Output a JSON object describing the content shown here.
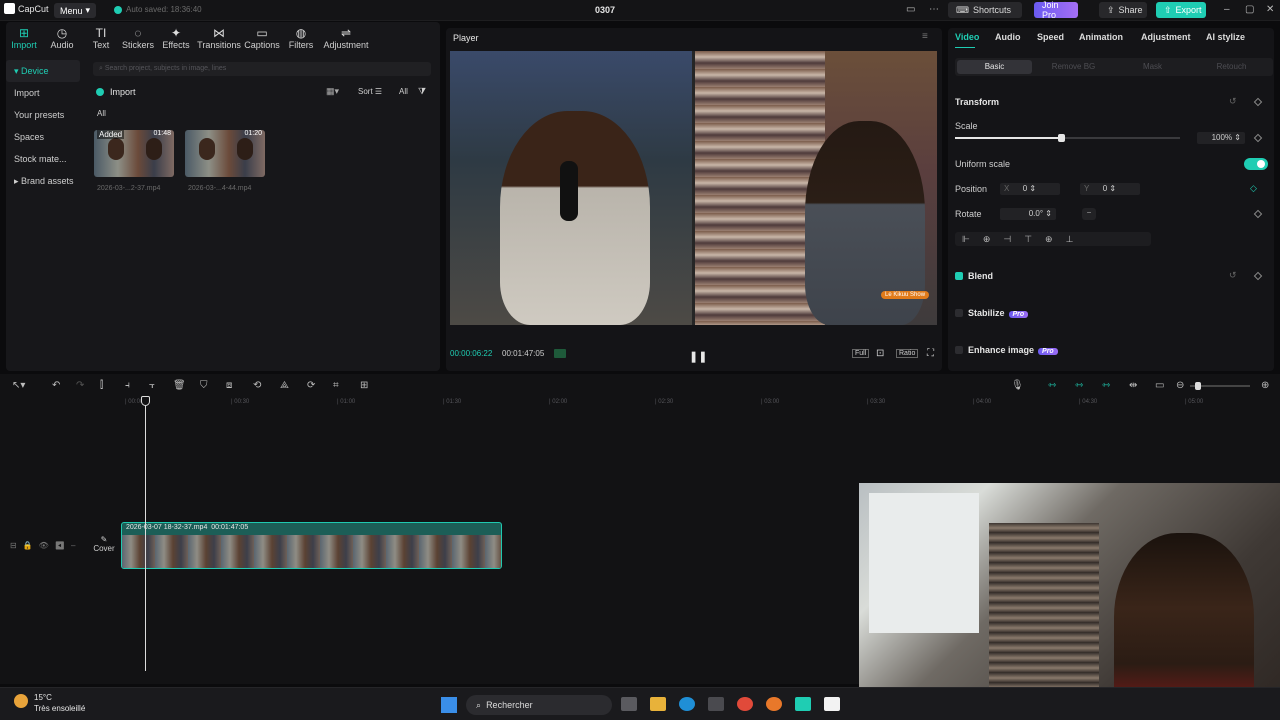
{
  "topbar": {
    "app_name": "CapCut",
    "menu_label": "Menu",
    "autosave": "Auto saved: 18:36:40",
    "project_title": "0307",
    "shortcuts": "Shortcuts",
    "join_pro": "Join Pro",
    "share": "Share",
    "export": "Export"
  },
  "media_tools": [
    {
      "label": "Import",
      "icon": "⊞"
    },
    {
      "label": "Audio",
      "icon": "◷"
    },
    {
      "label": "Text",
      "icon": "TI"
    },
    {
      "label": "Stickers",
      "icon": "◌"
    },
    {
      "label": "Effects",
      "icon": "✦"
    },
    {
      "label": "Transitions",
      "icon": "⋈"
    },
    {
      "label": "Captions",
      "icon": "▭"
    },
    {
      "label": "Filters",
      "icon": "◍"
    },
    {
      "label": "Adjustment",
      "icon": "⇌"
    }
  ],
  "side_nav": [
    {
      "label": "Device"
    },
    {
      "label": "Import"
    },
    {
      "label": "Your presets"
    },
    {
      "label": "Spaces"
    },
    {
      "label": "Stock mate..."
    },
    {
      "label": "Brand assets"
    }
  ],
  "media": {
    "search_placeholder": "Search project, subjects in image, lines",
    "import_label": "Import",
    "sort_label": "Sort",
    "all_filter": "All",
    "all_tab": "All",
    "items": [
      {
        "badge": "Added",
        "duration": "01:48",
        "name": "2026-03-...2-37.mp4"
      },
      {
        "badge": "",
        "duration": "01:20",
        "name": "2026-03-...4-44.mp4"
      }
    ]
  },
  "player": {
    "title": "Player",
    "current_time": "00:00:06:22",
    "total_time": "00:01:47:05",
    "watermark": "Le Kikuu Show",
    "full": "Full",
    "ratio": "Ratio"
  },
  "properties": {
    "tabs": [
      "Video",
      "Audio",
      "Speed",
      "Animation",
      "Adjustment",
      "AI stylize"
    ],
    "subtabs": [
      "Basic",
      "Remove BG",
      "Mask",
      "Retouch"
    ],
    "transform": "Transform",
    "scale_label": "Scale",
    "scale_value": "100%",
    "scale_level": 0.47,
    "uniform_scale": "Uniform scale",
    "position_label": "Position",
    "x_label": "X",
    "x_value": "0",
    "y_label": "Y",
    "y_value": "0",
    "rotate_label": "Rotate",
    "rotate_value": "0.0°",
    "blend": "Blend",
    "stabilize": "Stabilize",
    "enhance": "Enhance image",
    "pro": "Pro"
  },
  "timeline": {
    "ruler": [
      "00:00",
      "00:30",
      "01:00",
      "01:30",
      "02:00",
      "02:30",
      "03:00",
      "03:30",
      "04:00",
      "04:30",
      "05:00"
    ],
    "clip_name": "2026-03-07 18-32-37.mp4",
    "clip_duration": "00:01:47:05",
    "cover_label": "Cover"
  },
  "taskbar": {
    "temp": "15°C",
    "weather": "Très ensoleillé",
    "search": "Rechercher"
  },
  "colors": {
    "accent": "#1fcdb3",
    "pro": "#7b5cf2"
  }
}
